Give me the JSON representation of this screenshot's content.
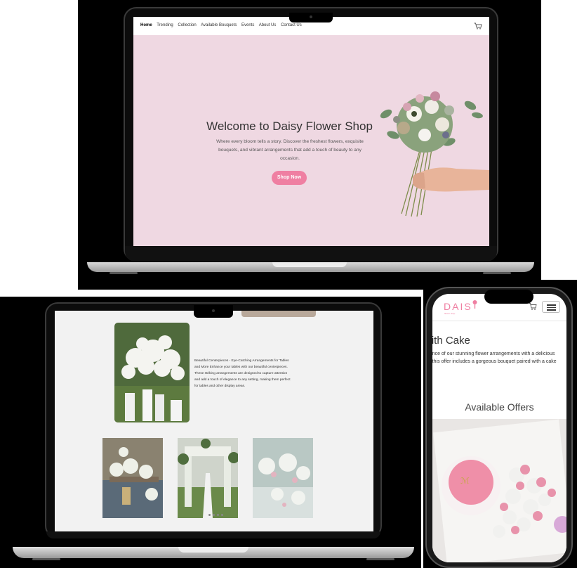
{
  "laptop_top": {
    "nav": {
      "links": [
        "Home",
        "Trending",
        "Collection",
        "Available Bouquets",
        "Events",
        "About Us",
        "Contact Us"
      ],
      "cart_icon": "cart-icon"
    },
    "hero": {
      "title": "Welcome to Daisy Flower Shop",
      "subtitle": "Where every bloom tells a story. Discover the freshest flowers, exquisite bouquets, and vibrant arrangements that add a touch of beauty to any occasion.",
      "button_label": "Shop Now",
      "image_icon": "bouquet-in-hand-image"
    }
  },
  "laptop_bottom": {
    "description": "Beautiful Centerpieces - Eye-Catching Arrangements for Tables and More Enhance your tables with our beautiful centerpieces. These striking arrangements are designed to capture attention and add a touch of elegance to any setting, making them perfect for tables and other display areas.",
    "gallery_icons": [
      "white-centerpiece-image",
      "table-arrangement-image",
      "wedding-arch-image",
      "event-decor-image"
    ]
  },
  "phone": {
    "logo": "DAIS",
    "logo_tagline": "flower shop",
    "section_title": "with Cake",
    "section_text_lines": [
      "egance of our stunning flower arrangements with a delicious",
      "on, this offer includes a gorgeous bouquet paired with a cake"
    ],
    "offers_heading": "Available Offers",
    "menu_icon": "hamburger-menu-icon",
    "cart_icon": "cart-icon"
  },
  "colors": {
    "hero_bg": "#efd8e2",
    "accent_pink": "#ef7fa2",
    "page_bg": "#f2f2f2"
  }
}
